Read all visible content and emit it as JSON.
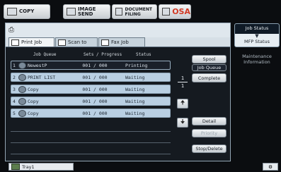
{
  "modes": [
    {
      "label": "COPY",
      "icon": "copy-icon"
    },
    {
      "label": "IMAGE SEND",
      "icon": "image-send-icon"
    },
    {
      "label": "DOCUMENT FILING",
      "icon": "document-filing-icon"
    },
    {
      "label": "OSA",
      "icon": "osa-icon"
    }
  ],
  "tabs": [
    {
      "label": "Print Job"
    },
    {
      "label": "Scan to"
    },
    {
      "label": "Fax Job"
    }
  ],
  "columns": {
    "queue": "Job Queue",
    "sets": "Sets / Progress",
    "status": "Status"
  },
  "jobs": [
    {
      "num": "1",
      "name": "NewestP",
      "sets": "001 / 000",
      "status": "Printing"
    },
    {
      "num": "2",
      "name": "PRINT LIST",
      "sets": "001 / 000",
      "status": "Waiting"
    },
    {
      "num": "3",
      "name": "Copy",
      "sets": "001 / 000",
      "status": "Waiting"
    },
    {
      "num": "4",
      "name": "Copy",
      "sets": "001 / 000",
      "status": "Waiting"
    },
    {
      "num": "5",
      "name": "Copy",
      "sets": "001 / 000",
      "status": "Waiting"
    }
  ],
  "side": {
    "spool": "Spool",
    "job_queue": "Job Queue",
    "complete": "Complete",
    "page_current": "1",
    "page_total": "1",
    "detail": "Detail",
    "priority": "Priority",
    "stop_delete": "Stop/Delete"
  },
  "right": {
    "job_status": "Job Status",
    "mfp_status": "MFP Status",
    "maintenance": "Maintenance Information"
  },
  "bottom": {
    "tray": "Tray1"
  }
}
